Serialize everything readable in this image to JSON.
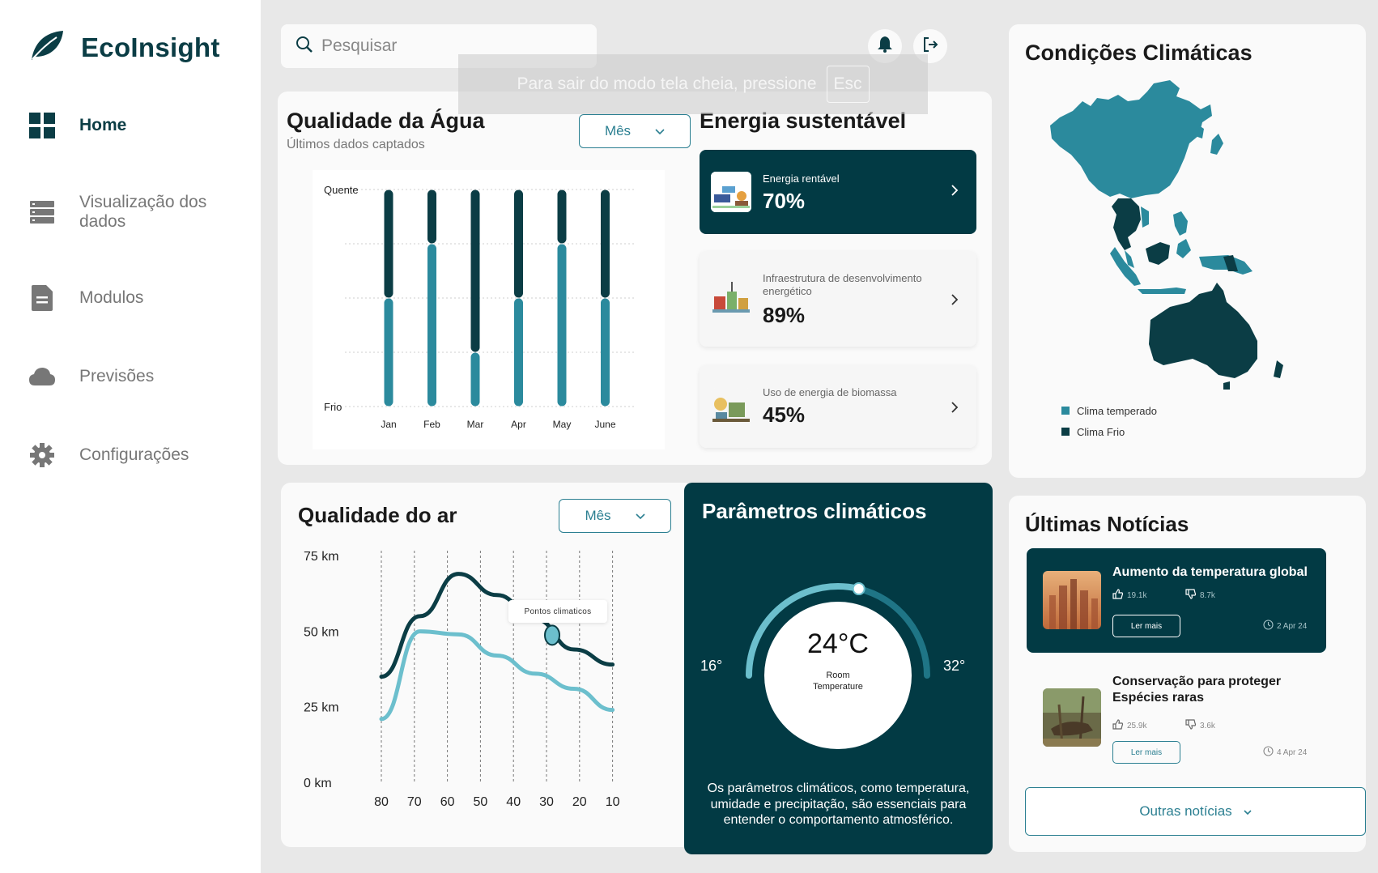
{
  "app": {
    "name": "EcoInsight"
  },
  "nav": [
    {
      "label": "Home",
      "icon": "dashboard-grid-icon",
      "active": true
    },
    {
      "label": "Visualização dos dados",
      "icon": "server-icon",
      "active": false
    },
    {
      "label": "Modulos",
      "icon": "document-icon",
      "active": false
    },
    {
      "label": "Previsões",
      "icon": "cloud-icon",
      "active": false
    },
    {
      "label": "Configurações",
      "icon": "gear-icon",
      "active": false
    }
  ],
  "search": {
    "placeholder": "Pesquisar"
  },
  "fullscreen_notice": {
    "text": "Para sair do modo tela cheia, pressione",
    "key": "Esc"
  },
  "water": {
    "title": "Qualidade da Água",
    "subtitle": "Últimos dados captados",
    "select": "Mês",
    "y_top": "Quente",
    "y_bottom": "Frio"
  },
  "energy": {
    "title": "Energia sustentável",
    "items": [
      {
        "label": "Energia rentável",
        "value": "70%"
      },
      {
        "label": "Infraestrutura de desenvolvimento energético",
        "value": "89%"
      },
      {
        "label": "Uso de energia de biomassa",
        "value": "45%"
      }
    ]
  },
  "map": {
    "title": "Condições Climáticas",
    "legend": [
      {
        "label": "Clima temperado",
        "color": "#2b8a9d"
      },
      {
        "label": "Clima Frio",
        "color": "#0b3d45"
      }
    ]
  },
  "air": {
    "title": "Qualidade do ar",
    "select": "Mês",
    "tooltip": "Pontos climaticos"
  },
  "climate": {
    "title": "Parâmetros climáticos",
    "temp": "24°C",
    "temp_label_1": "Room",
    "temp_label_2": "Temperature",
    "min": "16°",
    "max": "32°",
    "gauge_value": 24,
    "gauge_min": 16,
    "gauge_max": 32,
    "description": "Os parâmetros climáticos, como temperatura, umidade e precipitação, são essenciais para entender o comportamento atmosférico."
  },
  "news": {
    "title": "Últimas Notícias",
    "items": [
      {
        "title": "Aumento da temperatura global",
        "likes": "19.1k",
        "dislikes": "8.7k",
        "button": "Ler mais",
        "date": "2 Apr 24"
      },
      {
        "title": "Conservação para proteger Espécies raras",
        "likes": "25.9k",
        "dislikes": "3.6k",
        "button": "Ler mais",
        "date": "4 Apr 24"
      }
    ],
    "more": "Outras notícias"
  },
  "chart_data": [
    {
      "type": "bar",
      "title": "Qualidade da Água",
      "categories": [
        "Jan",
        "Feb",
        "Mar",
        "Apr",
        "May",
        "June"
      ],
      "ylim": [
        "Frio",
        "Quente"
      ],
      "series": [
        {
          "values": [
            0.5,
            0.75,
            0.25,
            0.5,
            0.75,
            0.5
          ],
          "color": "#2b8a9d"
        },
        {
          "values": [
            0.5,
            0.25,
            0.75,
            0.5,
            0.25,
            0.5
          ],
          "color": "#0b3d45"
        }
      ],
      "grid": true
    },
    {
      "type": "line",
      "title": "Qualidade do ar",
      "x": [
        80,
        70,
        60,
        50,
        40,
        30,
        20,
        10
      ],
      "yticks": [
        "75 km",
        "50 km",
        "25 km",
        "0 km"
      ],
      "ylim": [
        0,
        75
      ],
      "series": [
        {
          "values": [
            36,
            56,
            70,
            63,
            55,
            45,
            40
          ],
          "color": "#0b3d45"
        },
        {
          "values": [
            22,
            51,
            50,
            43,
            37,
            32,
            25
          ],
          "color": "#6cbfcd"
        }
      ],
      "grid": "vertical-dashed"
    }
  ]
}
